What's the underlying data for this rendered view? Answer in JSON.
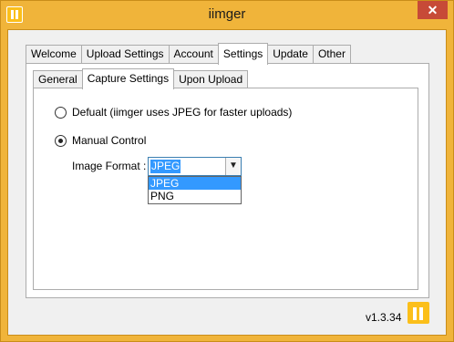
{
  "window": {
    "title": "iimger",
    "close_glyph": "✕",
    "icon": "iimger-logo-icon"
  },
  "outer_tabs": [
    {
      "label": "Welcome"
    },
    {
      "label": "Upload Settings"
    },
    {
      "label": "Account"
    },
    {
      "label": "Settings",
      "active": true
    },
    {
      "label": "Update"
    },
    {
      "label": "Other"
    }
  ],
  "inner_tabs": [
    {
      "label": "General"
    },
    {
      "label": "Capture Settings",
      "active": true
    },
    {
      "label": "Upon Upload"
    }
  ],
  "capture": {
    "default_option": {
      "label": "Defualt (iimger uses JPEG for faster uploads)",
      "checked": false
    },
    "manual_option": {
      "label": "Manual Control",
      "checked": true
    },
    "format_label": "Image Format :",
    "format_value": "JPEG",
    "format_options": [
      "JPEG",
      "PNG"
    ]
  },
  "footer": {
    "version": "v1.3.34"
  },
  "colors": {
    "frame": "#f0b43a",
    "accent": "#3399ff",
    "close": "#c74a37",
    "logo": "#fbbf1a"
  }
}
